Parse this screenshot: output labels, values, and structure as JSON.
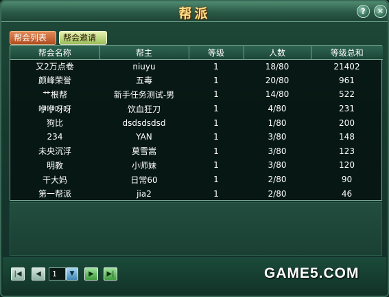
{
  "window": {
    "title": "帮派"
  },
  "tabs": [
    {
      "label": "帮会列表"
    },
    {
      "label": "帮会邀请"
    }
  ],
  "table": {
    "columns": [
      "帮会名称",
      "帮主",
      "等级",
      "人数",
      "等级总和"
    ],
    "rows": [
      [
        "又2万点卷",
        "niuyu",
        "1",
        "18/80",
        "21402"
      ],
      [
        "颜峰荣誉",
        "五毒",
        "1",
        "20/80",
        "961"
      ],
      [
        "艹根帮",
        "新手任务测试-男",
        "1",
        "14/80",
        "522"
      ],
      [
        "咿咿呀呀",
        "饮血狂刀",
        "1",
        "4/80",
        "231"
      ],
      [
        "狗比",
        "dsdsdsdsd",
        "1",
        "1/80",
        "200"
      ],
      [
        "234",
        "YAN",
        "1",
        "3/80",
        "148"
      ],
      [
        "未央沉浮",
        "莫雪嵩",
        "1",
        "3/80",
        "123"
      ],
      [
        "明教",
        "小师妹",
        "1",
        "3/80",
        "120"
      ],
      [
        "干大妈",
        "日常60",
        "1",
        "2/80",
        "90"
      ],
      [
        "第一帮派",
        "jia2",
        "1",
        "2/80",
        "46"
      ]
    ]
  },
  "pager": {
    "current_page": "1"
  },
  "watermark": "GAME5.COM",
  "colors": {
    "title_gold": "#ffe08a",
    "panel_green": "#1f4a3a",
    "tab_active": "#b24e22",
    "tab_inactive": "#9cbf5d"
  }
}
